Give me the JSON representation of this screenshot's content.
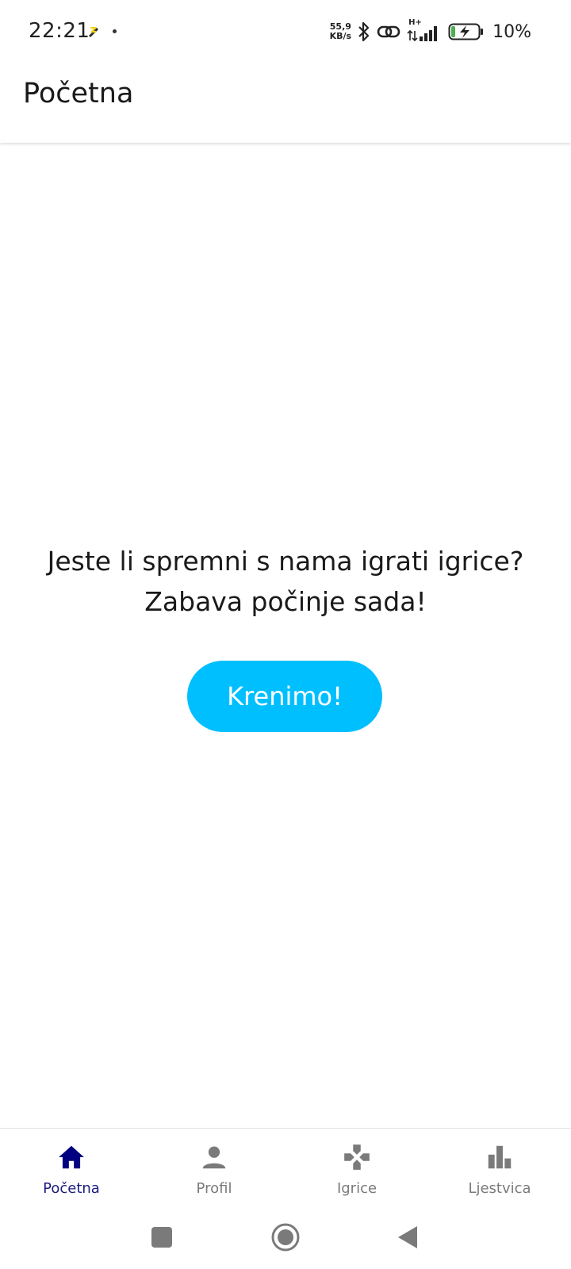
{
  "status_bar": {
    "time": "22:21",
    "net_speed_value": "55,9",
    "net_speed_unit": "KB/s",
    "network_type": "H+",
    "battery": "10%",
    "icons": [
      "notification-icon",
      "bluetooth-icon",
      "link-icon",
      "signal-icon",
      "battery-charging-icon"
    ]
  },
  "app_bar": {
    "title": "Početna"
  },
  "main": {
    "line1": "Jeste li spremni s nama igrati igrice?",
    "line2": "Zabava počinje sada!",
    "cta_label": "Krenimo!"
  },
  "bottom_nav": {
    "items": [
      {
        "label": "Početna",
        "icon": "home-icon",
        "active": true
      },
      {
        "label": "Profil",
        "icon": "person-icon",
        "active": false
      },
      {
        "label": "Igrice",
        "icon": "gamepad-icon",
        "active": false
      },
      {
        "label": "Ljestvica",
        "icon": "leaderboard-icon",
        "active": false
      }
    ]
  },
  "system_nav": {
    "icons": [
      "recents-square-icon",
      "home-circle-icon",
      "back-triangle-icon"
    ]
  },
  "colors": {
    "accent": "#00bfff",
    "nav_active": "#000080",
    "nav_inactive": "#7a7a7a",
    "battery_fill": "#4caf50"
  }
}
